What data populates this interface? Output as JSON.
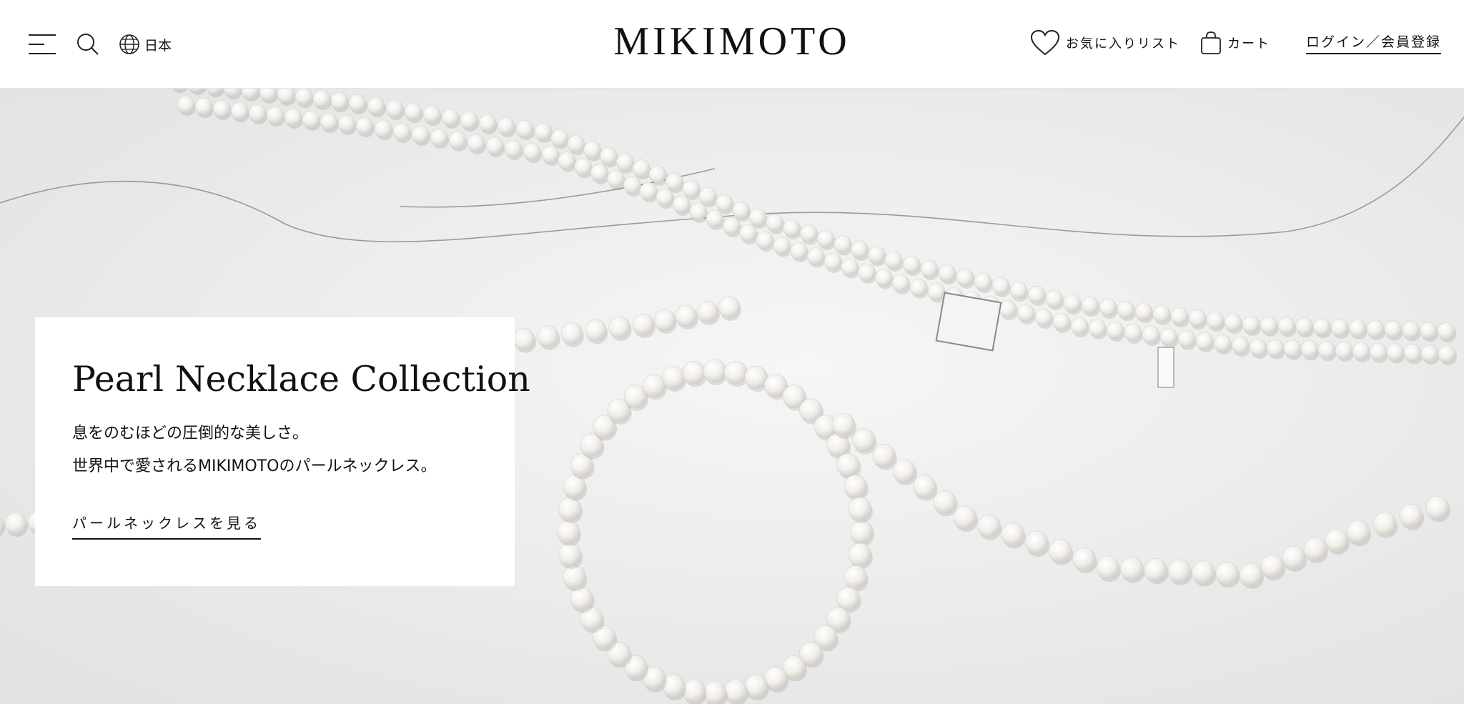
{
  "header": {
    "menu_icon": "hamburger-menu-icon",
    "search_icon": "search-icon",
    "language": {
      "icon": "globe-icon",
      "label": "日本"
    },
    "logo_text": "MIKIMOTO",
    "favorites": {
      "icon": "heart-icon",
      "label": "お気に入りリスト"
    },
    "cart": {
      "icon": "shopping-bag-icon",
      "label": "カート"
    },
    "login_label": "ログイン／会員登録"
  },
  "hero": {
    "image_subject": "pearl necklaces on white background",
    "card": {
      "title": "Pearl Necklace Collection",
      "lines": [
        "息をのむほどの圧倒的な美しさ。",
        "世界中で愛されるMIKIMOTOのパールネックレス。"
      ],
      "link_label": "パールネックレスを見る"
    }
  },
  "colors": {
    "text": "#111111",
    "background": "#ffffff",
    "hero_background": "#eeeeee",
    "pearl": "#f7f5f2"
  }
}
